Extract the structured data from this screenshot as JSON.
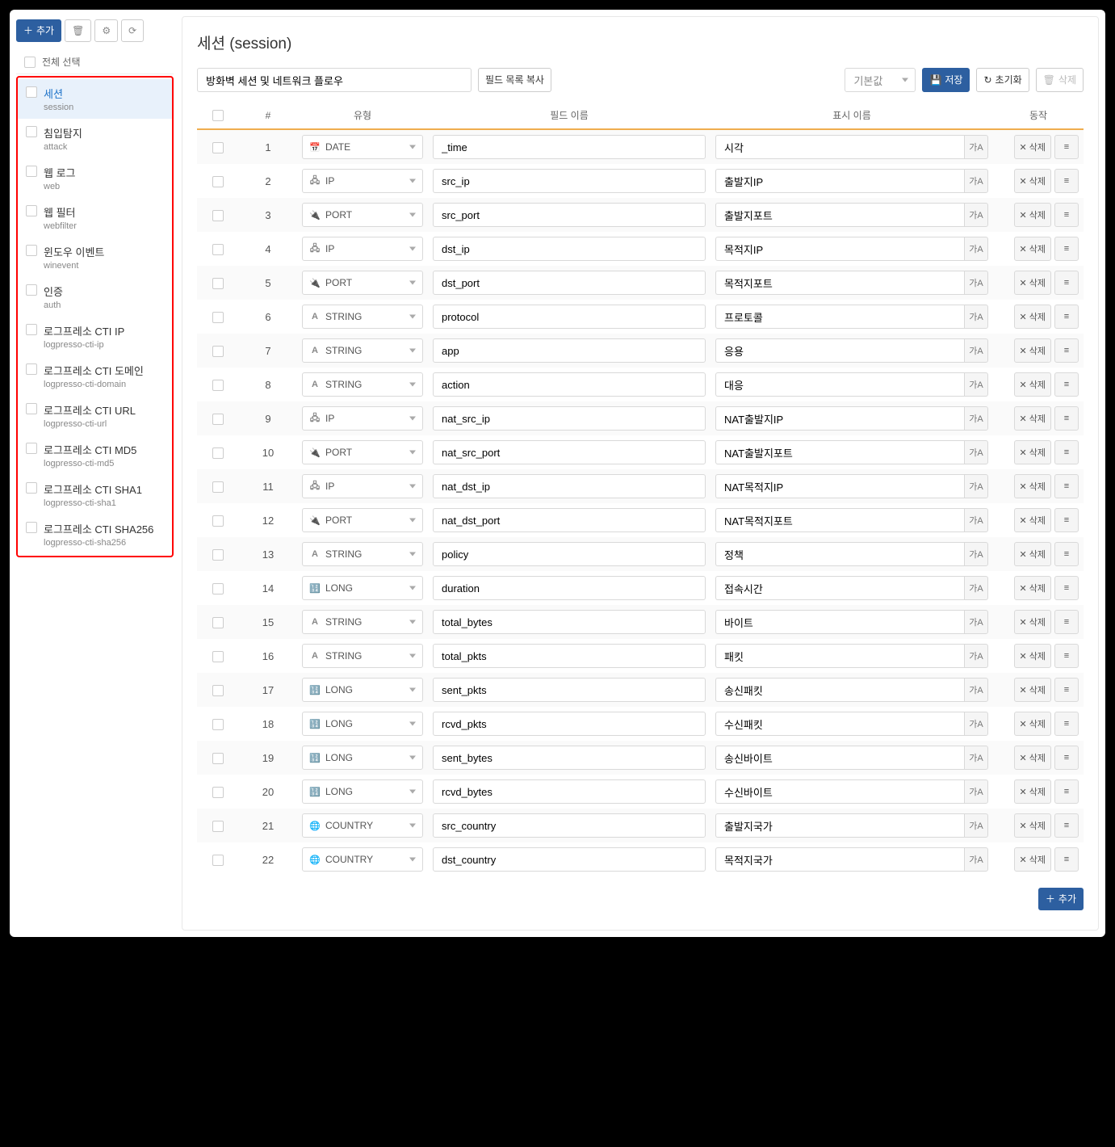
{
  "sidebar": {
    "add_button": "추가",
    "select_all": "전체 선택",
    "items": [
      {
        "label": "세션",
        "sub": "session",
        "active": true
      },
      {
        "label": "침입탐지",
        "sub": "attack",
        "active": false
      },
      {
        "label": "웹 로그",
        "sub": "web",
        "active": false
      },
      {
        "label": "웹 필터",
        "sub": "webfilter",
        "active": false
      },
      {
        "label": "윈도우 이벤트",
        "sub": "winevent",
        "active": false
      },
      {
        "label": "인증",
        "sub": "auth",
        "active": false
      },
      {
        "label": "로그프레소 CTI IP",
        "sub": "logpresso-cti-ip",
        "active": false
      },
      {
        "label": "로그프레소 CTI 도메인",
        "sub": "logpresso-cti-domain",
        "active": false
      },
      {
        "label": "로그프레소 CTI URL",
        "sub": "logpresso-cti-url",
        "active": false
      },
      {
        "label": "로그프레소 CTI MD5",
        "sub": "logpresso-cti-md5",
        "active": false
      },
      {
        "label": "로그프레소 CTI SHA1",
        "sub": "logpresso-cti-sha1",
        "active": false
      },
      {
        "label": "로그프레소 CTI SHA256",
        "sub": "logpresso-cti-sha256",
        "active": false
      }
    ]
  },
  "main": {
    "title": "세션 (session)",
    "description": "방화벽 세션 및 네트워크 플로우",
    "copy_fields_button": "필드 목록 복사",
    "default_select": "기본값",
    "save_button": "저장",
    "reset_button": "초기화",
    "delete_button": "삭제",
    "add_button": "추가",
    "headers": {
      "num": "#",
      "type": "유형",
      "field": "필드 이름",
      "display": "표시 이름",
      "action": "동작"
    },
    "row_delete": "삭제",
    "lang_btn": "가A",
    "rows": [
      {
        "n": 1,
        "type": "DATE",
        "icon": "date",
        "field": "_time",
        "display": "시각"
      },
      {
        "n": 2,
        "type": "IP",
        "icon": "ip",
        "field": "src_ip",
        "display": "출발지IP"
      },
      {
        "n": 3,
        "type": "PORT",
        "icon": "port",
        "field": "src_port",
        "display": "출발지포트"
      },
      {
        "n": 4,
        "type": "IP",
        "icon": "ip",
        "field": "dst_ip",
        "display": "목적지IP"
      },
      {
        "n": 5,
        "type": "PORT",
        "icon": "port",
        "field": "dst_port",
        "display": "목적지포트"
      },
      {
        "n": 6,
        "type": "STRING",
        "icon": "string",
        "field": "protocol",
        "display": "프로토콜"
      },
      {
        "n": 7,
        "type": "STRING",
        "icon": "string",
        "field": "app",
        "display": "응용"
      },
      {
        "n": 8,
        "type": "STRING",
        "icon": "string",
        "field": "action",
        "display": "대응"
      },
      {
        "n": 9,
        "type": "IP",
        "icon": "ip",
        "field": "nat_src_ip",
        "display": "NAT출발지IP"
      },
      {
        "n": 10,
        "type": "PORT",
        "icon": "port",
        "field": "nat_src_port",
        "display": "NAT출발지포트"
      },
      {
        "n": 11,
        "type": "IP",
        "icon": "ip",
        "field": "nat_dst_ip",
        "display": "NAT목적지IP"
      },
      {
        "n": 12,
        "type": "PORT",
        "icon": "port",
        "field": "nat_dst_port",
        "display": "NAT목적지포트"
      },
      {
        "n": 13,
        "type": "STRING",
        "icon": "string",
        "field": "policy",
        "display": "정책"
      },
      {
        "n": 14,
        "type": "LONG",
        "icon": "long",
        "field": "duration",
        "display": "접속시간"
      },
      {
        "n": 15,
        "type": "STRING",
        "icon": "string",
        "field": "total_bytes",
        "display": "바이트"
      },
      {
        "n": 16,
        "type": "STRING",
        "icon": "string",
        "field": "total_pkts",
        "display": "패킷"
      },
      {
        "n": 17,
        "type": "LONG",
        "icon": "long",
        "field": "sent_pkts",
        "display": "송신패킷"
      },
      {
        "n": 18,
        "type": "LONG",
        "icon": "long",
        "field": "rcvd_pkts",
        "display": "수신패킷"
      },
      {
        "n": 19,
        "type": "LONG",
        "icon": "long",
        "field": "sent_bytes",
        "display": "송신바이트"
      },
      {
        "n": 20,
        "type": "LONG",
        "icon": "long",
        "field": "rcvd_bytes",
        "display": "수신바이트"
      },
      {
        "n": 21,
        "type": "COUNTRY",
        "icon": "country",
        "field": "src_country",
        "display": "출발지국가"
      },
      {
        "n": 22,
        "type": "COUNTRY",
        "icon": "country",
        "field": "dst_country",
        "display": "목적지국가"
      }
    ]
  }
}
